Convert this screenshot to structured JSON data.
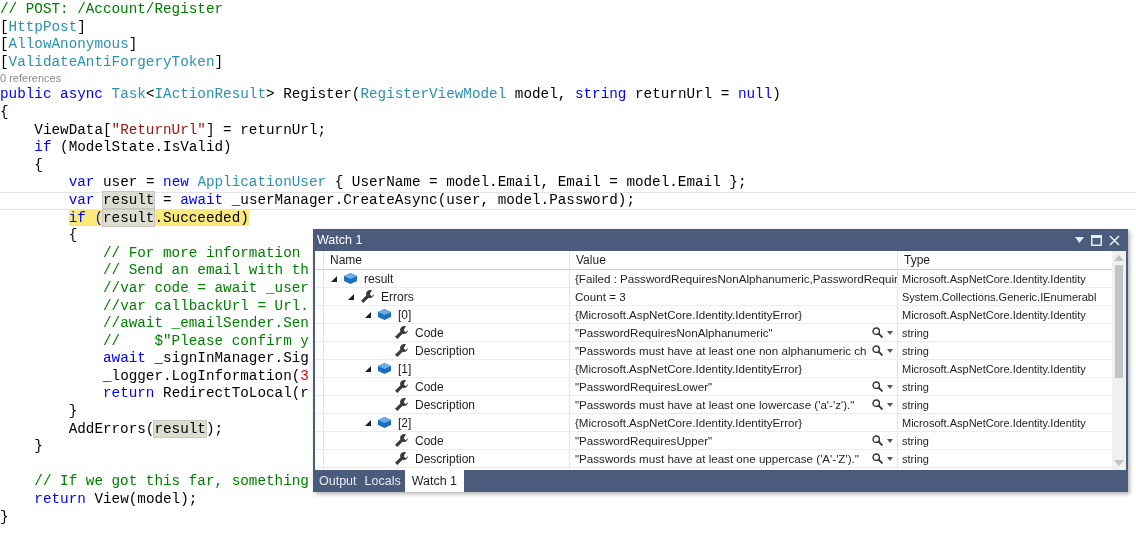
{
  "code_lines": [
    {
      "tokens": [
        {
          "text": "// POST: /Account/Register",
          "kind": "comment"
        }
      ]
    },
    {
      "tokens": [
        {
          "text": "[",
          "kind": "plain"
        },
        {
          "text": "HttpPost",
          "kind": "type"
        },
        {
          "text": "]",
          "kind": "plain"
        }
      ]
    },
    {
      "tokens": [
        {
          "text": "[",
          "kind": "plain"
        },
        {
          "text": "AllowAnonymous",
          "kind": "type"
        },
        {
          "text": "]",
          "kind": "plain"
        }
      ]
    },
    {
      "tokens": [
        {
          "text": "[",
          "kind": "plain"
        },
        {
          "text": "ValidateAntiForgeryToken",
          "kind": "type"
        },
        {
          "text": "]",
          "kind": "plain"
        }
      ]
    },
    {
      "kind": "codelens",
      "tokens": [
        {
          "text": "0 references",
          "kind": "plain"
        }
      ]
    },
    {
      "tokens": [
        {
          "text": "public async ",
          "kind": "keyword"
        },
        {
          "text": "Task",
          "kind": "type"
        },
        {
          "text": "<",
          "kind": "plain"
        },
        {
          "text": "IActionResult",
          "kind": "type"
        },
        {
          "text": "> Register(",
          "kind": "plain"
        },
        {
          "text": "RegisterViewModel",
          "kind": "type"
        },
        {
          "text": " model, ",
          "kind": "plain"
        },
        {
          "text": "string",
          "kind": "keyword"
        },
        {
          "text": " returnUrl = ",
          "kind": "plain"
        },
        {
          "text": "null",
          "kind": "keyword"
        },
        {
          "text": ")",
          "kind": "plain"
        }
      ]
    },
    {
      "tokens": [
        {
          "text": "{",
          "kind": "plain"
        }
      ]
    },
    {
      "tokens": [
        {
          "text": "    ViewData[",
          "kind": "plain"
        },
        {
          "text": "\"ReturnUrl\"",
          "kind": "string"
        },
        {
          "text": "] = returnUrl;",
          "kind": "plain"
        }
      ]
    },
    {
      "tokens": [
        {
          "text": "    if",
          "kind": "keyword"
        },
        {
          "text": " (ModelState.IsValid)",
          "kind": "plain"
        }
      ]
    },
    {
      "tokens": [
        {
          "text": "    {",
          "kind": "plain"
        }
      ]
    },
    {
      "tokens": [
        {
          "text": "        var",
          "kind": "keyword"
        },
        {
          "text": " user = ",
          "kind": "plain"
        },
        {
          "text": "new ",
          "kind": "keyword"
        },
        {
          "text": "ApplicationUser",
          "kind": "type"
        },
        {
          "text": " { UserName = model.Email, Email = model.Email };",
          "kind": "plain"
        }
      ]
    },
    {
      "current": true,
      "tokens": [
        {
          "text": "        var ",
          "kind": "keyword"
        },
        {
          "text": "result",
          "kind": "plain",
          "reference": true
        },
        {
          "text": " = ",
          "kind": "plain"
        },
        {
          "text": "await",
          "kind": "keyword"
        },
        {
          "text": " _userManager.CreateAsync(user, model.Password);",
          "kind": "plain"
        }
      ]
    },
    {
      "tokens": [
        {
          "text": "        if (",
          "kind": "keyword",
          "condition": true
        },
        {
          "text": "result",
          "kind": "plain",
          "reference": true
        },
        {
          "text": ".Succeeded)",
          "kind": "plain",
          "condition": true
        }
      ]
    },
    {
      "tokens": [
        {
          "text": "        {",
          "kind": "plain"
        }
      ]
    },
    {
      "tokens": [
        {
          "text": "            // For more information",
          "kind": "comment"
        }
      ]
    },
    {
      "tokens": [
        {
          "text": "            // Send an email with th",
          "kind": "comment"
        }
      ]
    },
    {
      "tokens": [
        {
          "text": "            //var code = await _user",
          "kind": "comment"
        }
      ]
    },
    {
      "tokens": [
        {
          "text": "            //var callbackUrl = Url.",
          "kind": "comment"
        }
      ]
    },
    {
      "tokens": [
        {
          "text": "            //await _emailSender.Sen",
          "kind": "comment"
        }
      ]
    },
    {
      "tokens": [
        {
          "text": "            //    $\"Please confirm y",
          "kind": "comment"
        }
      ]
    },
    {
      "tokens": [
        {
          "text": "            await",
          "kind": "keyword"
        },
        {
          "text": " _signInManager.Sig",
          "kind": "plain"
        }
      ]
    },
    {
      "tokens": [
        {
          "text": "            _logger.LogInformation(",
          "kind": "plain"
        },
        {
          "text": "3",
          "kind": "number"
        }
      ]
    },
    {
      "tokens": [
        {
          "text": "            return",
          "kind": "keyword"
        },
        {
          "text": " RedirectToLocal(r",
          "kind": "plain"
        }
      ]
    },
    {
      "tokens": [
        {
          "text": "        }",
          "kind": "plain"
        }
      ]
    },
    {
      "tokens": [
        {
          "text": "        AddErrors(",
          "kind": "plain"
        },
        {
          "text": "result",
          "kind": "plain",
          "reference": true
        },
        {
          "text": ");",
          "kind": "plain"
        }
      ]
    },
    {
      "tokens": [
        {
          "text": "    }",
          "kind": "plain"
        }
      ]
    },
    {
      "gap_before": true,
      "tokens": [
        {
          "text": "    // If we got this far, something",
          "kind": "comment"
        }
      ]
    },
    {
      "tokens": [
        {
          "text": "    return",
          "kind": "keyword"
        },
        {
          "text": " View(model);",
          "kind": "plain"
        }
      ]
    },
    {
      "tokens": [
        {
          "text": "}",
          "kind": "plain"
        }
      ]
    }
  ],
  "watch": {
    "title": "Watch 1",
    "columns": [
      "Name",
      "Value",
      "Type"
    ],
    "items": [
      {
        "name": "result",
        "kind": "object",
        "expanded": true,
        "value": "{Failed : PasswordRequiresNonAlphanumeric,PasswordRequir",
        "type": "Microsoft.AspNetCore.Identity.Identity",
        "children": [
          {
            "name": "Errors",
            "kind": "property",
            "expanded": true,
            "value": "Count = 3",
            "type": "System.Collections.Generic.IEnumerabl",
            "children": [
              {
                "name": "[0]",
                "kind": "object",
                "expanded": true,
                "value": "{Microsoft.AspNetCore.Identity.IdentityError}",
                "type": "Microsoft.AspNetCore.Identity.Identity",
                "children": [
                  {
                    "name": "Code",
                    "kind": "property",
                    "value": "\"PasswordRequiresNonAlphanumeric\"",
                    "visualizer": true,
                    "type": "string"
                  },
                  {
                    "name": "Description",
                    "kind": "property",
                    "value": "\"Passwords must have at least one non alphanumeric ch",
                    "visualizer": true,
                    "type": "string"
                  }
                ]
              },
              {
                "name": "[1]",
                "kind": "object",
                "expanded": true,
                "value": "{Microsoft.AspNetCore.Identity.IdentityError}",
                "type": "Microsoft.AspNetCore.Identity.Identity",
                "children": [
                  {
                    "name": "Code",
                    "kind": "property",
                    "value": "\"PasswordRequiresLower\"",
                    "visualizer": true,
                    "type": "string"
                  },
                  {
                    "name": "Description",
                    "kind": "property",
                    "value": "\"Passwords must have at least one lowercase ('a'-'z').\"",
                    "visualizer": true,
                    "type": "string"
                  }
                ]
              },
              {
                "name": "[2]",
                "kind": "object",
                "expanded": true,
                "value": "{Microsoft.AspNetCore.Identity.IdentityError}",
                "type": "Microsoft.AspNetCore.Identity.Identity",
                "children": [
                  {
                    "name": "Code",
                    "kind": "property",
                    "value": "\"PasswordRequiresUpper\"",
                    "visualizer": true,
                    "type": "string"
                  },
                  {
                    "name": "Description",
                    "kind": "property",
                    "value": "\"Passwords must have at least one uppercase ('A'-'Z').\"",
                    "visualizer": true,
                    "type": "string"
                  }
                ]
              }
            ]
          }
        ]
      }
    ],
    "tabs": [
      {
        "label": "Output",
        "selected": false
      },
      {
        "label": "Locals",
        "selected": false
      },
      {
        "label": "Watch 1",
        "selected": true
      }
    ]
  }
}
